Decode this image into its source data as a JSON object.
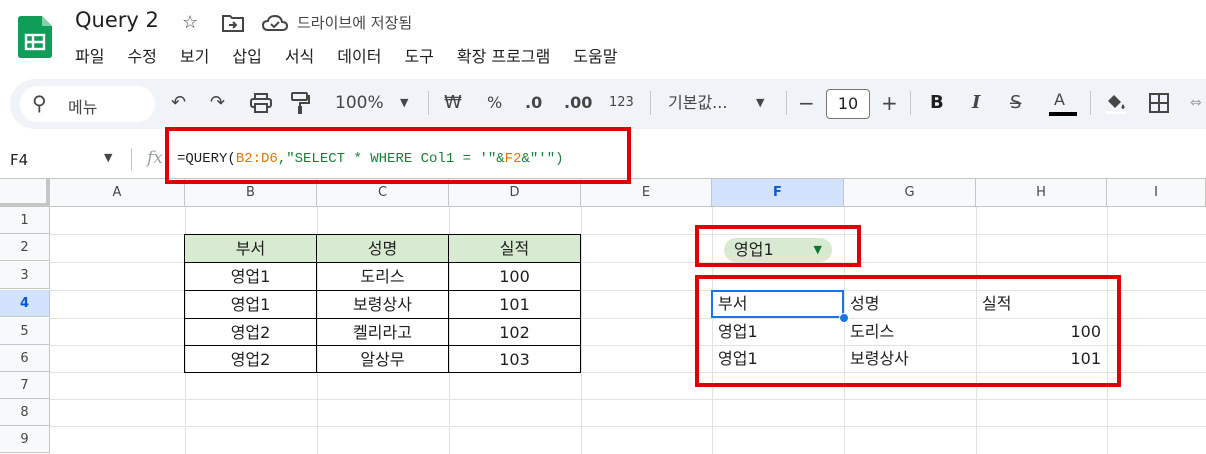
{
  "app": {
    "title": "Query 2",
    "save_status": "드라이브에 저장됨",
    "brand_color": "#0f9d58"
  },
  "menubar": [
    "파일",
    "수정",
    "보기",
    "삽입",
    "서식",
    "데이터",
    "도구",
    "확장 프로그램",
    "도움말"
  ],
  "toolbar": {
    "menu_search": "메뉴",
    "zoom": "100%",
    "currency": "₩",
    "percent": "%",
    "dec_decrease": ".0",
    "dec_increase": ".00",
    "number_format": "123",
    "font_name": "기본값...",
    "font_size": "10",
    "bold": "B",
    "italic": "I",
    "text_color": "A"
  },
  "formula_bar": {
    "name_box": "F4",
    "fx": "fx",
    "formula_prefix": "=QUERY(",
    "formula_ref": "B2:D6",
    "formula_mid": ",\"SELECT * WHERE Col1 = '\"&",
    "formula_ref2": "F2",
    "formula_end": "&\"'\")"
  },
  "columns": [
    "A",
    "B",
    "C",
    "D",
    "E",
    "F",
    "G",
    "H",
    "I"
  ],
  "selected_column": "F",
  "rows": [
    "1",
    "2",
    "3",
    "4",
    "5",
    "6",
    "7",
    "8",
    "9"
  ],
  "selected_row": "4",
  "source_table": {
    "headers": [
      "부서",
      "성명",
      "실적"
    ],
    "rows": [
      [
        "영업1",
        "도리스",
        "100"
      ],
      [
        "영업1",
        "보령상사",
        "101"
      ],
      [
        "영업2",
        "켈리라고",
        "102"
      ],
      [
        "영업2",
        "알상무",
        "103"
      ]
    ]
  },
  "filter_dropdown": {
    "value": "영업1"
  },
  "result_table": {
    "headers": [
      "부서",
      "성명",
      "실적"
    ],
    "rows": [
      [
        "영업1",
        "도리스",
        "100"
      ],
      [
        "영업1",
        "보령상사",
        "101"
      ]
    ]
  },
  "colors": {
    "header_fill": "#d9ead3",
    "highlight_red": "#e00000",
    "selection_blue": "#1a73e8"
  }
}
